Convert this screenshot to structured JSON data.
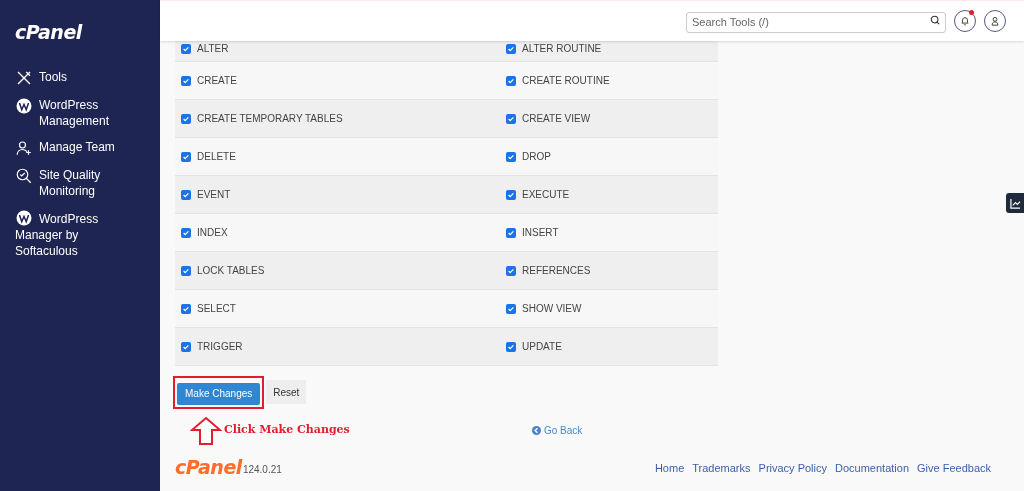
{
  "sidebar": {
    "logo": "cPanel",
    "items": [
      {
        "label": "Tools",
        "kind": "tools"
      },
      {
        "label": "WordPress Management",
        "kind": "wordpress"
      },
      {
        "label": "Manage Team",
        "kind": "team"
      },
      {
        "label": "Site Quality Monitoring",
        "kind": "quality"
      },
      {
        "label": "WordPress Manager by Softaculous",
        "kind": "wordpress"
      }
    ]
  },
  "header": {
    "search": {
      "placeholder": "Search Tools (/)"
    },
    "notification_unread": true
  },
  "privileges": [
    [
      {
        "label": "ALTER",
        "checked": true
      },
      {
        "label": "ALTER ROUTINE",
        "checked": true
      }
    ],
    [
      {
        "label": "CREATE",
        "checked": true
      },
      {
        "label": "CREATE ROUTINE",
        "checked": true
      }
    ],
    [
      {
        "label": "CREATE TEMPORARY TABLES",
        "checked": true
      },
      {
        "label": "CREATE VIEW",
        "checked": true
      }
    ],
    [
      {
        "label": "DELETE",
        "checked": true
      },
      {
        "label": "DROP",
        "checked": true
      }
    ],
    [
      {
        "label": "EVENT",
        "checked": true
      },
      {
        "label": "EXECUTE",
        "checked": true
      }
    ],
    [
      {
        "label": "INDEX",
        "checked": true
      },
      {
        "label": "INSERT",
        "checked": true
      }
    ],
    [
      {
        "label": "LOCK TABLES",
        "checked": true
      },
      {
        "label": "REFERENCES",
        "checked": true
      }
    ],
    [
      {
        "label": "SELECT",
        "checked": true
      },
      {
        "label": "SHOW VIEW",
        "checked": true
      }
    ],
    [
      {
        "label": "TRIGGER",
        "checked": true
      },
      {
        "label": "UPDATE",
        "checked": true
      }
    ]
  ],
  "buttons": [
    "Make Changes",
    "Reset"
  ],
  "annotation": "Click Make Changes",
  "go_back": "Go Back",
  "footer": {
    "logo": "cPanel",
    "version": "124.0.21",
    "links": [
      "Home",
      "Trademarks",
      "Privacy Policy",
      "Documentation",
      "Give Feedback"
    ]
  }
}
